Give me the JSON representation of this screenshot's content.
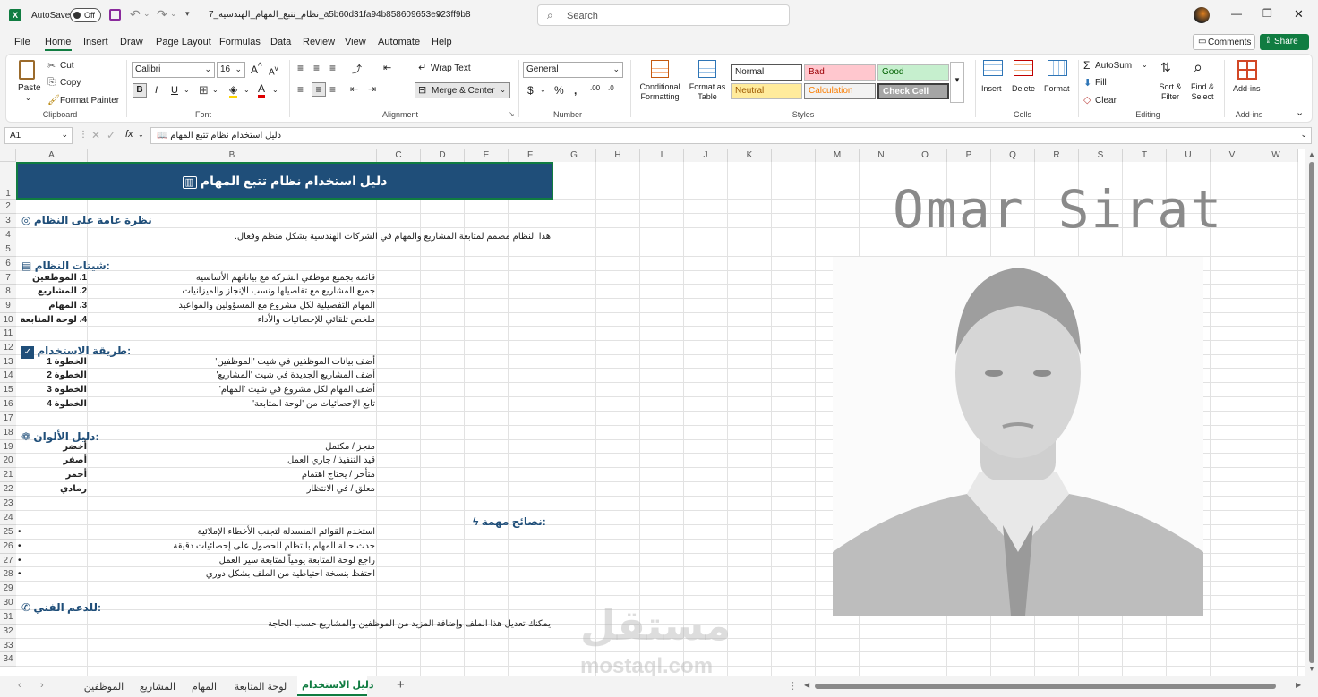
{
  "titlebar": {
    "autosave_label": "AutoSave",
    "autosave_state": "Off",
    "filename": "7_نظام_تتبع_المهام_الهندسية_a5b60d31fa94b858609653e923ff9b8",
    "search_placeholder": "Search"
  },
  "menu": [
    "File",
    "Home",
    "Insert",
    "Draw",
    "Page Layout",
    "Formulas",
    "Data",
    "Review",
    "View",
    "Automate",
    "Help"
  ],
  "menu_active": "Home",
  "actions": {
    "comments": "Comments",
    "share": "Share"
  },
  "ribbon": {
    "clipboard": {
      "paste": "Paste",
      "cut": "Cut",
      "copy": "Copy",
      "format_painter": "Format Painter",
      "group": "Clipboard"
    },
    "font": {
      "name": "Calibri",
      "size": "16",
      "group": "Font"
    },
    "alignment": {
      "wrap": "Wrap Text",
      "merge": "Merge & Center",
      "group": "Alignment"
    },
    "number": {
      "format": "General",
      "group": "Number"
    },
    "styles": {
      "conditional": "Conditional Formatting",
      "format_table": "Format as Table",
      "normal": "Normal",
      "bad": "Bad",
      "good": "Good",
      "neutral": "Neutral",
      "calculation": "Calculation",
      "check_cell": "Check Cell",
      "group": "Styles"
    },
    "cells": {
      "insert": "Insert",
      "delete": "Delete",
      "format": "Format",
      "group": "Cells"
    },
    "editing": {
      "autosum": "AutoSum",
      "fill": "Fill",
      "clear": "Clear",
      "sort": "Sort & Filter",
      "find": "Find & Select",
      "group": "Editing"
    },
    "addins": {
      "label": "Add-ins",
      "group": "Add-ins"
    }
  },
  "formula_bar": {
    "name_box": "A1",
    "fx": "fx",
    "formula": "دليل استخدام نظام تتبع المهام 📖"
  },
  "columns": [
    "A",
    "B",
    "C",
    "D",
    "E",
    "F",
    "G",
    "H",
    "I",
    "J",
    "K",
    "L",
    "M",
    "N",
    "O",
    "P",
    "Q",
    "R",
    "S",
    "T",
    "U",
    "V",
    "W"
  ],
  "rows": [
    "1",
    "2",
    "3",
    "4",
    "5",
    "6",
    "7",
    "8",
    "9",
    "10",
    "11",
    "12",
    "13",
    "14",
    "15",
    "16",
    "17",
    "18",
    "19",
    "20",
    "21",
    "22",
    "23",
    "24",
    "25",
    "26",
    "27",
    "28",
    "29",
    "30",
    "31",
    "32",
    "33",
    "34"
  ],
  "sheet": {
    "header": "دليل استخدام نظام تتبع المهام",
    "overview_title": "نظرة عامة على النظام",
    "overview_text": "هذا النظام مصمم لمتابعة المشاريع والمهام في الشركات الهندسية بشكل منظم وفعال.",
    "sheets_title": "شيتات النظام:",
    "sheets": [
      {
        "a": "1. الموظفين",
        "b": "قائمة بجميع موظفي الشركة مع بياناتهم الأساسية"
      },
      {
        "a": "2. المشاريع",
        "b": "جميع المشاريع مع تفاصيلها ونسب الإنجاز والميزانيات"
      },
      {
        "a": "3. المهام",
        "b": "المهام التفصيلية لكل مشروع مع المسؤولين والمواعيد"
      },
      {
        "a": "4. لوحة المتابعة",
        "b": "ملخص تلقائي للإحصائيات والأداء"
      }
    ],
    "usage_title": "طريقة الاستخدام:",
    "steps": [
      {
        "a": "الخطوة 1",
        "b": "أضف بيانات الموظفين في شيت 'الموظفين'"
      },
      {
        "a": "الخطوة 2",
        "b": "أضف المشاريع الجديدة في شيت 'المشاريع'"
      },
      {
        "a": "الخطوة 3",
        "b": "أضف المهام لكل مشروع في شيت 'المهام'"
      },
      {
        "a": "الخطوة 4",
        "b": "تابع الإحصائيات من 'لوحة المتابعة'"
      }
    ],
    "colors_title": "دليل الألوان:",
    "colors": [
      {
        "a": "أخضر",
        "b": "منجز / مكتمل"
      },
      {
        "a": "أصفر",
        "b": "قيد التنفيذ / جاري العمل"
      },
      {
        "a": "أحمر",
        "b": "متأخر / يحتاج اهتمام"
      },
      {
        "a": "رمادي",
        "b": "معلق / في الانتظار"
      }
    ],
    "tips_title": "نصائح مهمة:",
    "tips": [
      "استخدم القوائم المنسدلة لتجنب الأخطاء الإملائية",
      "حدث حالة المهام بانتظام للحصول على إحصائيات دقيقة",
      "راجع لوحة المتابعة يومياً لمتابعة سير العمل",
      "احتفظ بنسخة احتياطية من الملف بشكل دوري"
    ],
    "bullet": "•",
    "support_title": "للدعم الفني:",
    "support_text": "يمكنك تعديل هذا الملف وإضافة المزيد من الموظفين والمشاريع حسب الحاجة"
  },
  "overlay": {
    "name": "Omar Sirat",
    "watermark_ar": "مستقل",
    "watermark_en": "mostaql.com"
  },
  "tabs": [
    "دليل الاستخدام",
    "لوحة المتابعة",
    "المهام",
    "المشاريع",
    "الموظفين"
  ],
  "active_tab": "دليل الاستخدام",
  "colors": {
    "header_bg": "#1f4e79",
    "accent_green": "#107c41",
    "section_text": "#1f4e79"
  }
}
